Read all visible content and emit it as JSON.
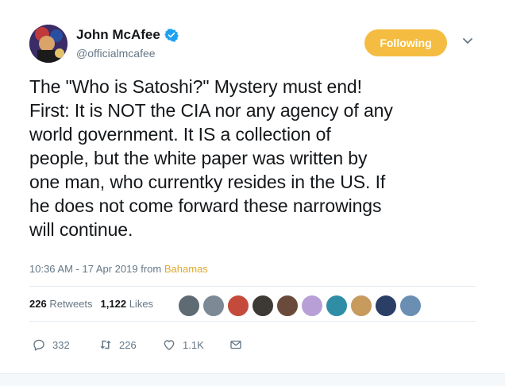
{
  "user": {
    "display_name": "John McAfee",
    "handle": "@officialmcafee",
    "verified": true
  },
  "follow_button": {
    "label": "Following",
    "color": "#f4bd41"
  },
  "tweet": {
    "lines": [
      "The \"Who is Satoshi?\" Mystery must end!",
      "First: It is NOT the CIA nor any agency of any",
      "world government. It IS a collection of",
      "people, but the white paper was written by",
      "one man, who currentky resides in the US. If",
      "he does not come forward these narrowings",
      "will continue."
    ],
    "timestamp": "10:36 AM - 17 Apr 2019 from",
    "location": "Bahamas"
  },
  "stats": {
    "retweets_count": "226",
    "retweets_label": "Retweets",
    "likes_count": "1,122",
    "likes_label": "Likes"
  },
  "likers": [
    "#5f6b73",
    "#7d8a96",
    "#c44b3c",
    "#3d3a36",
    "#6a4a3a",
    "#b8a0d6",
    "#2f8ea6",
    "#c79a5d",
    "#2b3f66",
    "#6a8fb3"
  ],
  "actions": {
    "replies": "332",
    "retweets": "226",
    "likes": "1.1K"
  }
}
